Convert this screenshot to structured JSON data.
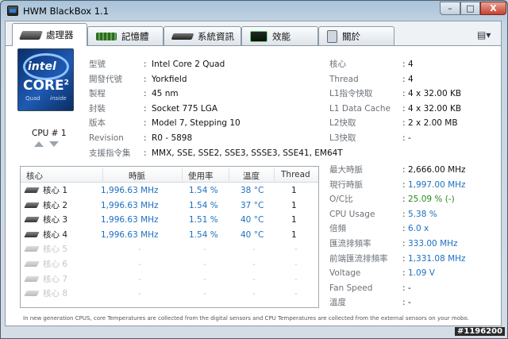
{
  "window": {
    "title": "HWM BlackBox 1.1",
    "min": "–",
    "max": "□",
    "close": "X"
  },
  "tabs": [
    {
      "label": "處理器",
      "icon": "cpu-chip-icon"
    },
    {
      "label": "記憶體",
      "icon": "memory-module-icon"
    },
    {
      "label": "系統資訊",
      "icon": "system-board-icon"
    },
    {
      "label": "效能",
      "icon": "performance-monitor-icon"
    },
    {
      "label": "關於",
      "icon": "about-document-icon"
    }
  ],
  "menu_icon": "▤▾",
  "cpu": {
    "label": "CPU # 1"
  },
  "info_rows": [
    {
      "label": "型號",
      "value": "Intel Core 2 Quad"
    },
    {
      "label": "開發代號",
      "value": "Yorkfield"
    },
    {
      "label": "製程",
      "value": "45 nm"
    },
    {
      "label": "封裝",
      "value": "Socket 775 LGA"
    },
    {
      "label": "版本",
      "value": "Model 7, Stepping 10"
    },
    {
      "label": "Revision",
      "value": "R0 - 5898"
    },
    {
      "label": "支援指令集",
      "value": "MMX, SSE, SSE2, SSE3, SSSE3, SSE41, EM64T"
    }
  ],
  "cache_rows": [
    {
      "label": "核心",
      "value": "4"
    },
    {
      "label": "Thread",
      "value": "4"
    },
    {
      "label": "L1指令快取",
      "value": "4 x 32.00 KB"
    },
    {
      "label": "L1 Data Cache",
      "value": "4 x 32.00 KB"
    },
    {
      "label": "L2快取",
      "value": "2 x 2.00 MB"
    },
    {
      "label": "L3快取",
      "value": "-"
    }
  ],
  "perf_rows": [
    {
      "label": "最大時脈",
      "value": "2,666.00 MHz",
      "color": "#111111"
    },
    {
      "label": "現行時脈",
      "value": "1,997.00 MHz",
      "color": "#1d6fc1"
    },
    {
      "label": "O/C比",
      "value": "25.09 % (-)",
      "color": "#2a8a1f"
    },
    {
      "label": "CPU Usage",
      "value": "5.38 %",
      "color": "#1d6fc1"
    },
    {
      "label": "倍頻",
      "value": "6.0 x",
      "color": "#1d6fc1"
    },
    {
      "label": "匯流排頻率",
      "value": "333.00 MHz",
      "color": "#1d6fc1"
    },
    {
      "label": "前端匯流排頻率",
      "value": "1,331.08 MHz",
      "color": "#1d6fc1"
    },
    {
      "label": "Voltage",
      "value": "1.09 V",
      "color": "#1d6fc1"
    },
    {
      "label": "Fan Speed",
      "value": "-",
      "color": "#111111"
    },
    {
      "label": "溫度",
      "value": "-",
      "color": "#111111"
    }
  ],
  "core_table": {
    "headers": [
      "核心",
      "時脈",
      "使用率",
      "溫度",
      "Thread"
    ],
    "rows": [
      {
        "name": "核心 1",
        "clock": "1,996.63 MHz",
        "usage": "1.54 %",
        "temp": "38 °C",
        "thread": "1",
        "active": true
      },
      {
        "name": "核心 2",
        "clock": "1,996.63 MHz",
        "usage": "1.54 %",
        "temp": "37 °C",
        "thread": "1",
        "active": true
      },
      {
        "name": "核心 3",
        "clock": "1,996.63 MHz",
        "usage": "1.51 %",
        "temp": "40 °C",
        "thread": "1",
        "active": true
      },
      {
        "name": "核心 4",
        "clock": "1,996.63 MHz",
        "usage": "1.54 %",
        "temp": "40 °C",
        "thread": "1",
        "active": true
      },
      {
        "name": "核心 5",
        "clock": "-",
        "usage": "-",
        "temp": "-",
        "thread": "-",
        "active": false
      },
      {
        "name": "核心 6",
        "clock": "-",
        "usage": "-",
        "temp": "-",
        "thread": "-",
        "active": false
      },
      {
        "name": "核心 7",
        "clock": "-",
        "usage": "-",
        "temp": "-",
        "thread": "-",
        "active": false
      },
      {
        "name": "核心 8",
        "clock": "-",
        "usage": "-",
        "temp": "-",
        "thread": "-",
        "active": false
      }
    ]
  },
  "footer": "In new generation CPUS, core Temperatures are collected from the digital sensors and CPU Temperatures are collected from the external sensors on your mobo.",
  "watermark": "#1196200",
  "colors": {
    "accent_blue": "#1d6fc1",
    "accent_green": "#2a8a1f"
  }
}
